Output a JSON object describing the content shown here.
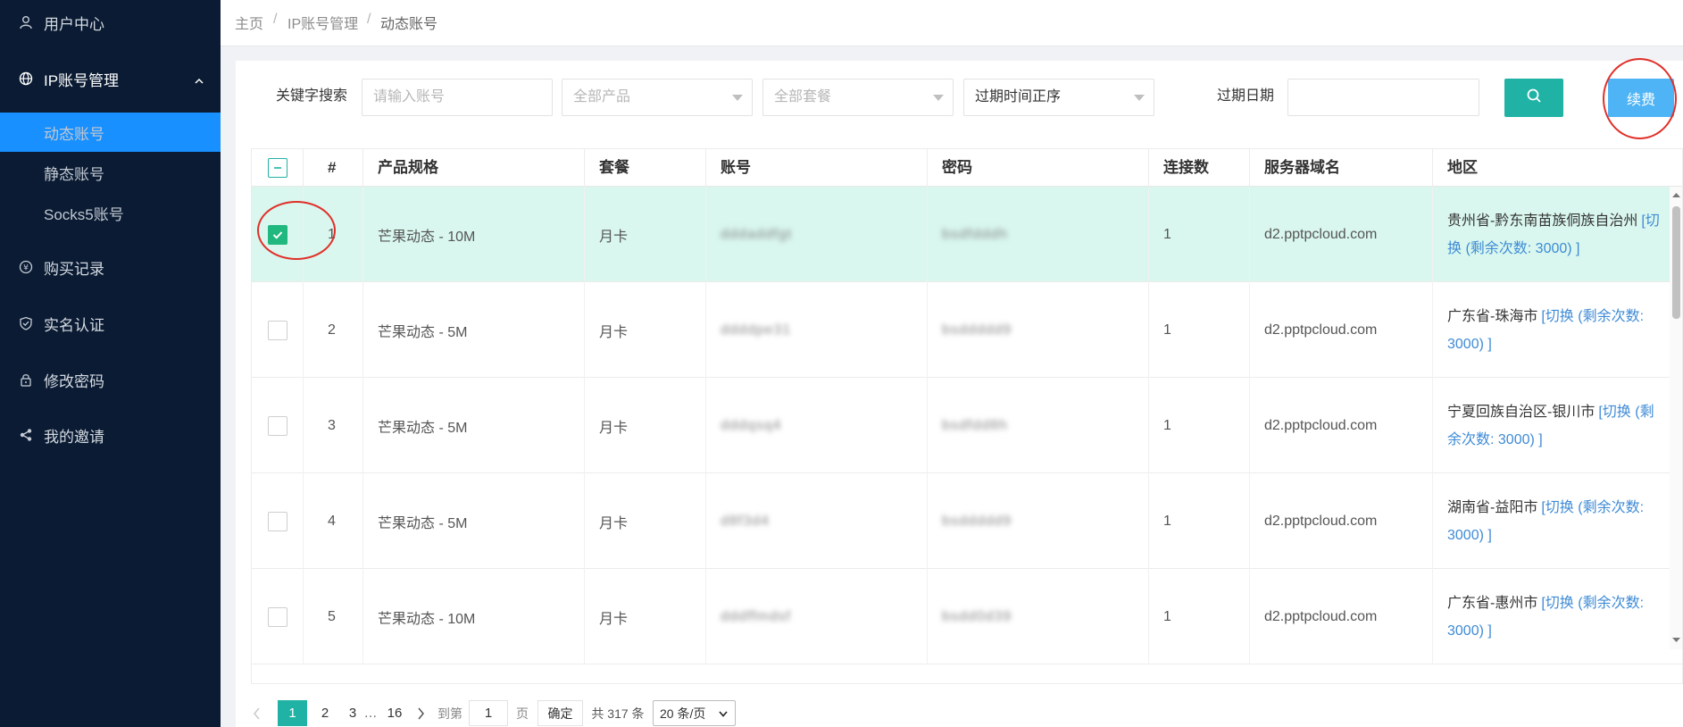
{
  "sidebar": {
    "items": [
      {
        "label": "用户中心",
        "icon": "user-icon"
      },
      {
        "label": "IP账号管理",
        "icon": "globe-icon"
      },
      {
        "label": "动态账号"
      },
      {
        "label": "静态账号"
      },
      {
        "label": "Socks5账号"
      },
      {
        "label": "购买记录",
        "icon": "yen-icon"
      },
      {
        "label": "实名认证",
        "icon": "shield-icon"
      },
      {
        "label": "修改密码",
        "icon": "lock-icon"
      },
      {
        "label": "我的邀请",
        "icon": "share-icon"
      }
    ]
  },
  "breadcrumb": {
    "home": "主页",
    "sep1": "/",
    "section": "IP账号管理",
    "sep2": "/",
    "current": "动态账号"
  },
  "filters": {
    "keyword_label": "关键字搜索",
    "keyword_placeholder": "请输入账号",
    "product_placeholder": "全部产品",
    "plan_placeholder": "全部套餐",
    "sort_value": "过期时间正序",
    "expire_label": "过期日期",
    "renew_label": "续费"
  },
  "table": {
    "headers": [
      "#",
      "产品规格",
      "套餐",
      "账号",
      "密码",
      "连接数",
      "服务器域名",
      "地区"
    ],
    "rows": [
      {
        "num": "1",
        "spec": "芒果动态 - 10M",
        "plan": "月卡",
        "account": "dddaddfgt",
        "password": "bsdfdddh",
        "conn": "1",
        "server": "d2.pptpcloud.com",
        "region": "贵州省-黔东南苗族侗族自治州",
        "switch": "[切换 (剩余次数: 3000) ]",
        "checked": true
      },
      {
        "num": "2",
        "spec": "芒果动态 - 5M",
        "plan": "月卡",
        "account": "ddddpe31",
        "password": "bsddddd9",
        "conn": "1",
        "server": "d2.pptpcloud.com",
        "region": "广东省-珠海市",
        "switch": "[切换 (剩余次数: 3000) ]",
        "checked": false
      },
      {
        "num": "3",
        "spec": "芒果动态 - 5M",
        "plan": "月卡",
        "account": "dddqsq4",
        "password": "bsdfdd8h",
        "conn": "1",
        "server": "d2.pptpcloud.com",
        "region": "宁夏回族自治区-银川市",
        "switch": "[切换 (剩余次数: 3000) ]",
        "checked": false
      },
      {
        "num": "4",
        "spec": "芒果动态 - 5M",
        "plan": "月卡",
        "account": "d8f3d4",
        "password": "bsddddd9",
        "conn": "1",
        "server": "d2.pptpcloud.com",
        "region": "湖南省-益阳市",
        "switch": "[切换 (剩余次数: 3000) ]",
        "checked": false
      },
      {
        "num": "5",
        "spec": "芒果动态 - 10M",
        "plan": "月卡",
        "account": "dddffmdsf",
        "password": "bsdd0d39",
        "conn": "1",
        "server": "d2.pptpcloud.com",
        "region": "广东省-惠州市",
        "switch": "[切换 (剩余次数: 3000) ]",
        "checked": false
      }
    ]
  },
  "pagination": {
    "pages": [
      "1",
      "2",
      "3",
      "…",
      "16"
    ],
    "goto_label": "到第",
    "goto_value": "1",
    "page_unit": "页",
    "confirm": "确定",
    "total": "共 317 条",
    "page_size": "20 条/页"
  },
  "colors": {
    "sidebar_bg": "#0a1b33",
    "active": "#1890ff",
    "teal": "#20b2a4",
    "selected_row": "#d9f7ee",
    "link": "#3f8bd6",
    "annotation": "#e0302a"
  }
}
